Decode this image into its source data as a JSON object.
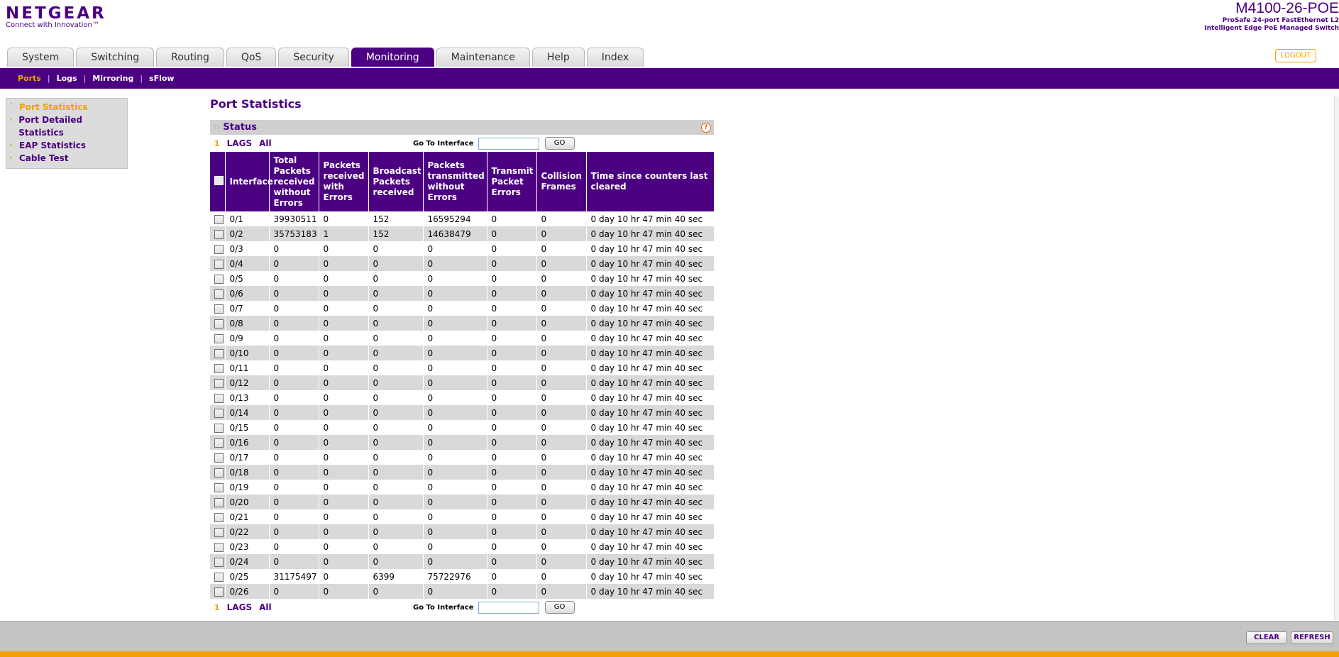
{
  "brand": {
    "logo": "NETGEAR",
    "tagline": "Connect with Innovation™"
  },
  "device": {
    "model": "M4100-26-POE",
    "desc1": "ProSafe 24-port FastEthernet L2",
    "desc2": "Intelligent Edge PoE Managed Switch"
  },
  "tabs": [
    "System",
    "Switching",
    "Routing",
    "QoS",
    "Security",
    "Monitoring",
    "Maintenance",
    "Help",
    "Index"
  ],
  "active_tab": "Monitoring",
  "logout_label": "LOGOUT",
  "subnav": [
    "Ports",
    "Logs",
    "Mirroring",
    "sFlow"
  ],
  "leftmenu": [
    "Port Statistics",
    "Port Detailed Statistics",
    "EAP Statistics",
    "Cable Test"
  ],
  "page": {
    "title": "Port Statistics",
    "panel_title": "Status",
    "help": "?",
    "filter": {
      "num": "1",
      "lags": "LAGS",
      "all": "All",
      "goto_label": "Go To Interface",
      "go_label": "GO"
    }
  },
  "table": {
    "headers": [
      "Interface",
      "Total Packets received without Errors",
      "Packets received with Errors",
      "Broadcast Packets received",
      "Packets transmitted without Errors",
      "Transmit Packet Errors",
      "Collision Frames",
      "Time since counters last cleared"
    ],
    "rows": [
      [
        "0/1",
        "39930511",
        "0",
        "152",
        "16595294",
        "0",
        "0",
        "0 day 10 hr 47 min 40 sec"
      ],
      [
        "0/2",
        "35753183",
        "1",
        "152",
        "14638479",
        "0",
        "0",
        "0 day 10 hr 47 min 40 sec"
      ],
      [
        "0/3",
        "0",
        "0",
        "0",
        "0",
        "0",
        "0",
        "0 day 10 hr 47 min 40 sec"
      ],
      [
        "0/4",
        "0",
        "0",
        "0",
        "0",
        "0",
        "0",
        "0 day 10 hr 47 min 40 sec"
      ],
      [
        "0/5",
        "0",
        "0",
        "0",
        "0",
        "0",
        "0",
        "0 day 10 hr 47 min 40 sec"
      ],
      [
        "0/6",
        "0",
        "0",
        "0",
        "0",
        "0",
        "0",
        "0 day 10 hr 47 min 40 sec"
      ],
      [
        "0/7",
        "0",
        "0",
        "0",
        "0",
        "0",
        "0",
        "0 day 10 hr 47 min 40 sec"
      ],
      [
        "0/8",
        "0",
        "0",
        "0",
        "0",
        "0",
        "0",
        "0 day 10 hr 47 min 40 sec"
      ],
      [
        "0/9",
        "0",
        "0",
        "0",
        "0",
        "0",
        "0",
        "0 day 10 hr 47 min 40 sec"
      ],
      [
        "0/10",
        "0",
        "0",
        "0",
        "0",
        "0",
        "0",
        "0 day 10 hr 47 min 40 sec"
      ],
      [
        "0/11",
        "0",
        "0",
        "0",
        "0",
        "0",
        "0",
        "0 day 10 hr 47 min 40 sec"
      ],
      [
        "0/12",
        "0",
        "0",
        "0",
        "0",
        "0",
        "0",
        "0 day 10 hr 47 min 40 sec"
      ],
      [
        "0/13",
        "0",
        "0",
        "0",
        "0",
        "0",
        "0",
        "0 day 10 hr 47 min 40 sec"
      ],
      [
        "0/14",
        "0",
        "0",
        "0",
        "0",
        "0",
        "0",
        "0 day 10 hr 47 min 40 sec"
      ],
      [
        "0/15",
        "0",
        "0",
        "0",
        "0",
        "0",
        "0",
        "0 day 10 hr 47 min 40 sec"
      ],
      [
        "0/16",
        "0",
        "0",
        "0",
        "0",
        "0",
        "0",
        "0 day 10 hr 47 min 40 sec"
      ],
      [
        "0/17",
        "0",
        "0",
        "0",
        "0",
        "0",
        "0",
        "0 day 10 hr 47 min 40 sec"
      ],
      [
        "0/18",
        "0",
        "0",
        "0",
        "0",
        "0",
        "0",
        "0 day 10 hr 47 min 40 sec"
      ],
      [
        "0/19",
        "0",
        "0",
        "0",
        "0",
        "0",
        "0",
        "0 day 10 hr 47 min 40 sec"
      ],
      [
        "0/20",
        "0",
        "0",
        "0",
        "0",
        "0",
        "0",
        "0 day 10 hr 47 min 40 sec"
      ],
      [
        "0/21",
        "0",
        "0",
        "0",
        "0",
        "0",
        "0",
        "0 day 10 hr 47 min 40 sec"
      ],
      [
        "0/22",
        "0",
        "0",
        "0",
        "0",
        "0",
        "0",
        "0 day 10 hr 47 min 40 sec"
      ],
      [
        "0/23",
        "0",
        "0",
        "0",
        "0",
        "0",
        "0",
        "0 day 10 hr 47 min 40 sec"
      ],
      [
        "0/24",
        "0",
        "0",
        "0",
        "0",
        "0",
        "0",
        "0 day 10 hr 47 min 40 sec"
      ],
      [
        "0/25",
        "31175497",
        "0",
        "6399",
        "75722976",
        "0",
        "0",
        "0 day 10 hr 47 min 40 sec"
      ],
      [
        "0/26",
        "0",
        "0",
        "0",
        "0",
        "0",
        "0",
        "0 day 10 hr 47 min 40 sec"
      ]
    ]
  },
  "buttons": {
    "clear": "CLEAR",
    "refresh": "REFRESH"
  },
  "colors": {
    "brand": "#4b0082",
    "accent": "#f0a000"
  }
}
